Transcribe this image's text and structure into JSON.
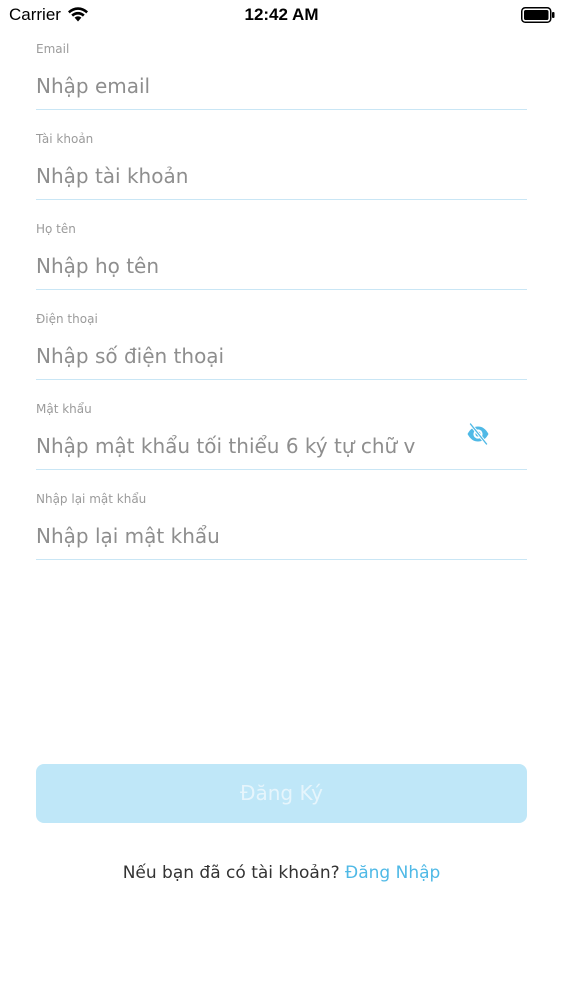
{
  "status_bar": {
    "carrier": "Carrier",
    "time": "12:42 AM",
    "icons": [
      "wifi-icon",
      "battery-icon"
    ]
  },
  "form": {
    "fields": [
      {
        "label": "Email",
        "placeholder": "Nhập email",
        "value": ""
      },
      {
        "label": "Tài khoản",
        "placeholder": "Nhập tài khoản",
        "value": ""
      },
      {
        "label": "Họ tên",
        "placeholder": "Nhập họ tên",
        "value": ""
      },
      {
        "label": "Điện thoại",
        "placeholder": "Nhập số điện thoại",
        "value": ""
      },
      {
        "label": "Mật khẩu",
        "placeholder": "Nhập mật khẩu tối thiểu 6 ký tự chữ v",
        "value": "",
        "icon": "eye-slash-icon"
      },
      {
        "label": "Nhập lại mật khẩu",
        "placeholder": "Nhập lại mật khẩu",
        "value": ""
      }
    ]
  },
  "register_button": {
    "label": "Đăng Ký"
  },
  "footer": {
    "prompt": "Nếu bạn đã có tài khoản? ",
    "login_link": "Đăng Nhập"
  },
  "colors": {
    "accent": "#4fb9e6",
    "button_bg": "#bfe7f8",
    "divider": "#c9e6f5",
    "label": "#9b9b9b"
  }
}
